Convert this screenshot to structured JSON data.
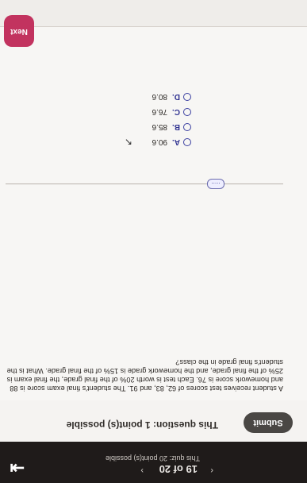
{
  "header": {
    "pager": "19 of 20",
    "quiz_status": "This quiz: 20 point(s) possible",
    "points": "This question: 1 point(s) possible",
    "submit_label": "Submit"
  },
  "question": {
    "text": "A student receives test scores of 62, 83, and 91. The student's final exam score is 88 and homework score is 76. Each test is worth 20% of the final grade, the final exam is 25% of the final grade, and the homework grade is 15% of the final grade. What is the student's final grade in the class?",
    "options": [
      {
        "letter": "A.",
        "value": "90.6"
      },
      {
        "letter": "B.",
        "value": "85.6"
      },
      {
        "letter": "C.",
        "value": "76.6"
      },
      {
        "letter": "D.",
        "value": "80.6"
      }
    ],
    "more_label": "....."
  },
  "footer": {
    "next_label": "Next"
  }
}
